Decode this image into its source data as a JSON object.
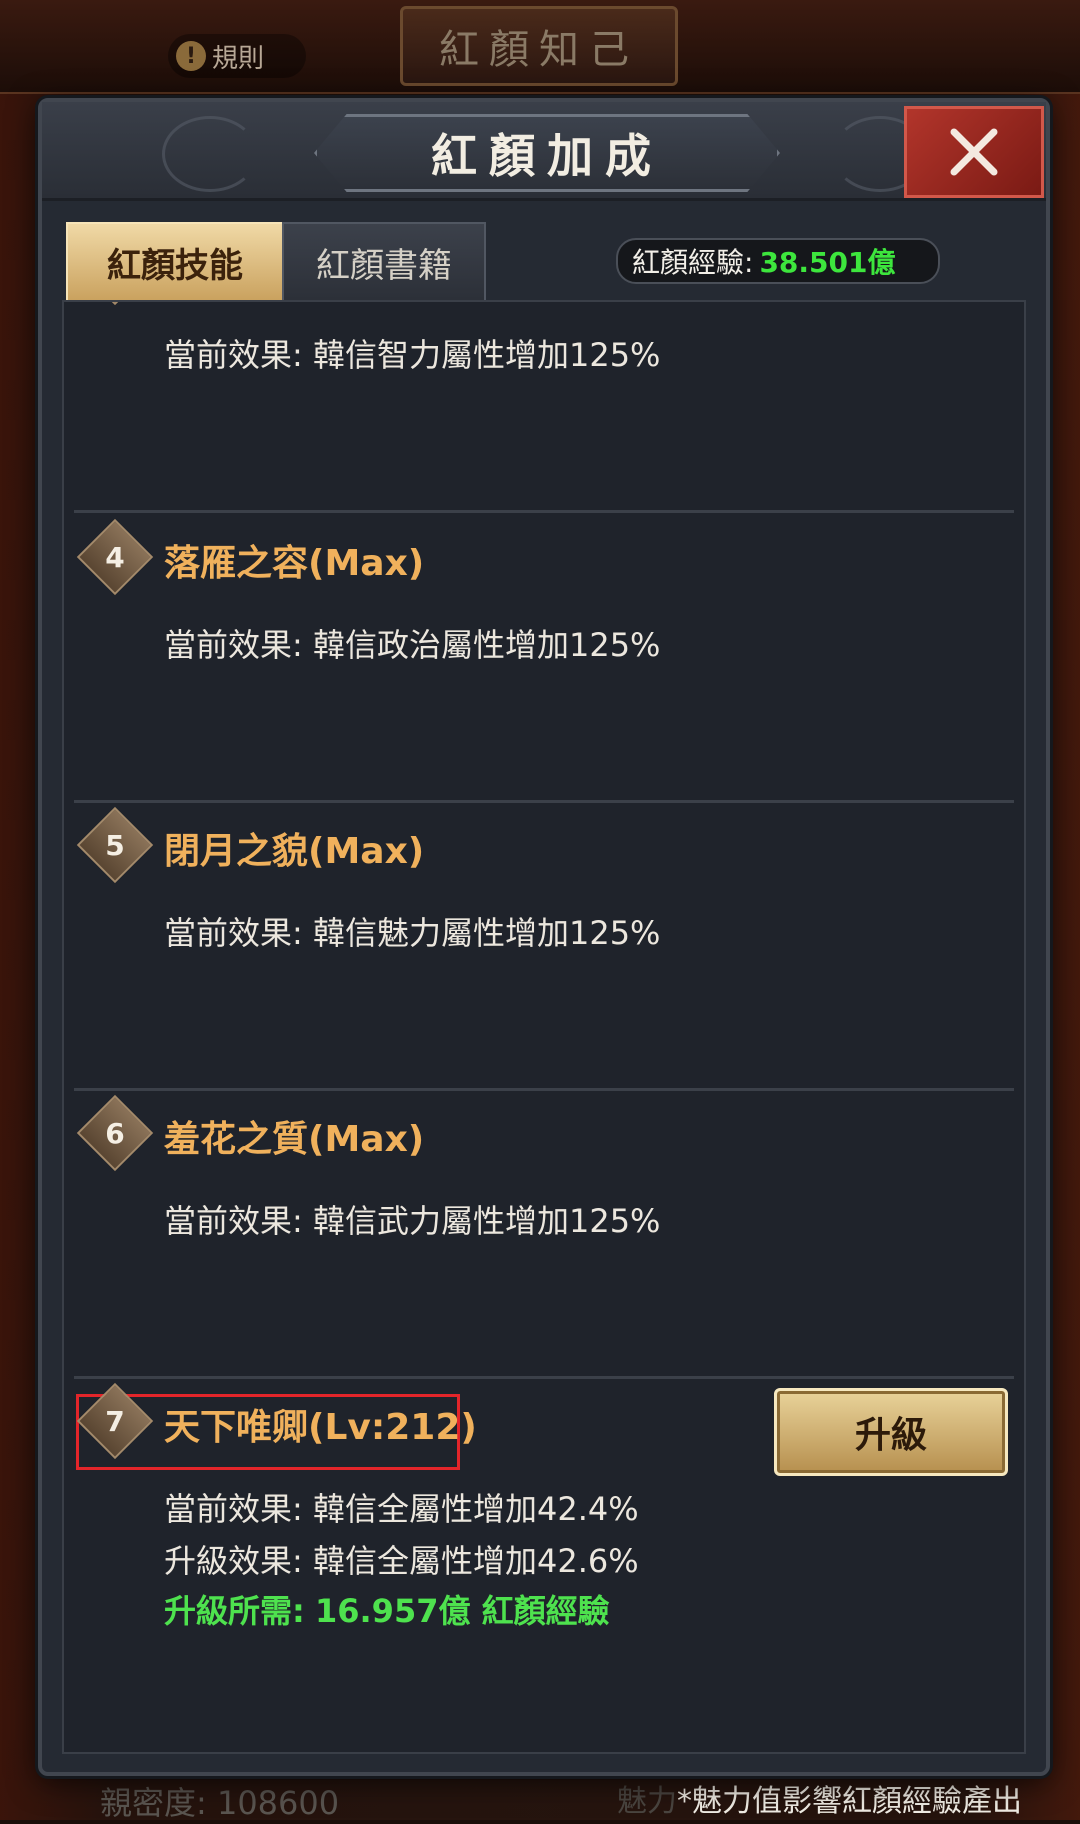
{
  "background": {
    "window_title": "紅顏知己",
    "rules_label": "規則",
    "intimacy": "親密度: 108600",
    "footnote_prefix": "魅力",
    "footnote": "*魅力值影響紅顏經驗產出"
  },
  "dialog": {
    "title": "紅顏加成",
    "close_label": "✕"
  },
  "tabs": [
    {
      "label": "紅顏技能",
      "active": true
    },
    {
      "label": "紅顏書籍",
      "active": false
    }
  ],
  "experience": {
    "label": "紅顏經驗:",
    "value": "38.501億"
  },
  "skills": [
    {
      "num": "",
      "name": "",
      "effect_label": "當前效果:",
      "effect": "韓信智力屬性增加125%"
    },
    {
      "num": "4",
      "name": "落雁之容(Max)",
      "effect_label": "當前效果:",
      "effect": "韓信政治屬性增加125%"
    },
    {
      "num": "5",
      "name": "閉月之貌(Max)",
      "effect_label": "當前效果:",
      "effect": "韓信魅力屬性增加125%"
    },
    {
      "num": "6",
      "name": "羞花之質(Max)",
      "effect_label": "當前效果:",
      "effect": "韓信武力屬性增加125%"
    },
    {
      "num": "7",
      "name": "天下唯卿(Lv:212)",
      "effect_label": "當前效果:",
      "effect": "韓信全屬性增加42.4%",
      "upgrade_effect_label": "升級效果:",
      "upgrade_effect": "韓信全屬性增加42.6%",
      "requirement_label": "升級所需:",
      "requirement": "16.957億 紅顏經驗",
      "upgrade_button": "升級"
    }
  ],
  "colors": {
    "skill_name": "#f0b15c",
    "requirement_green": "#4ee24e",
    "exp_green": "#3de63d",
    "highlight_red": "#e3252a"
  }
}
